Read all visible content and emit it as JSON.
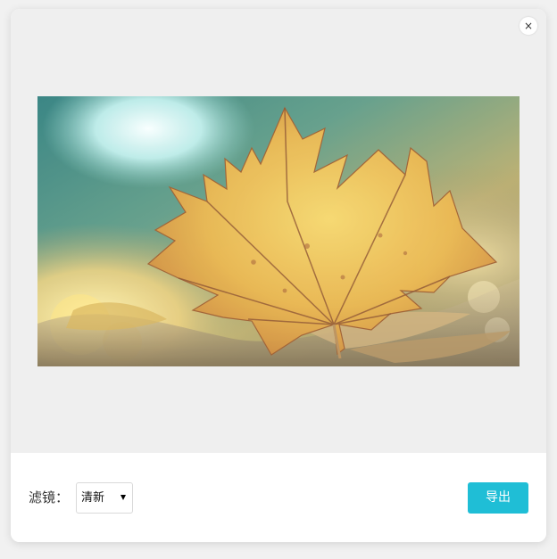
{
  "dialog": {
    "close_label": "×"
  },
  "filter": {
    "label": "滤镜：",
    "selected": "清新"
  },
  "actions": {
    "export_label": "导出"
  },
  "colors": {
    "accent": "#1fbed6",
    "preview_background": "#efefef"
  }
}
